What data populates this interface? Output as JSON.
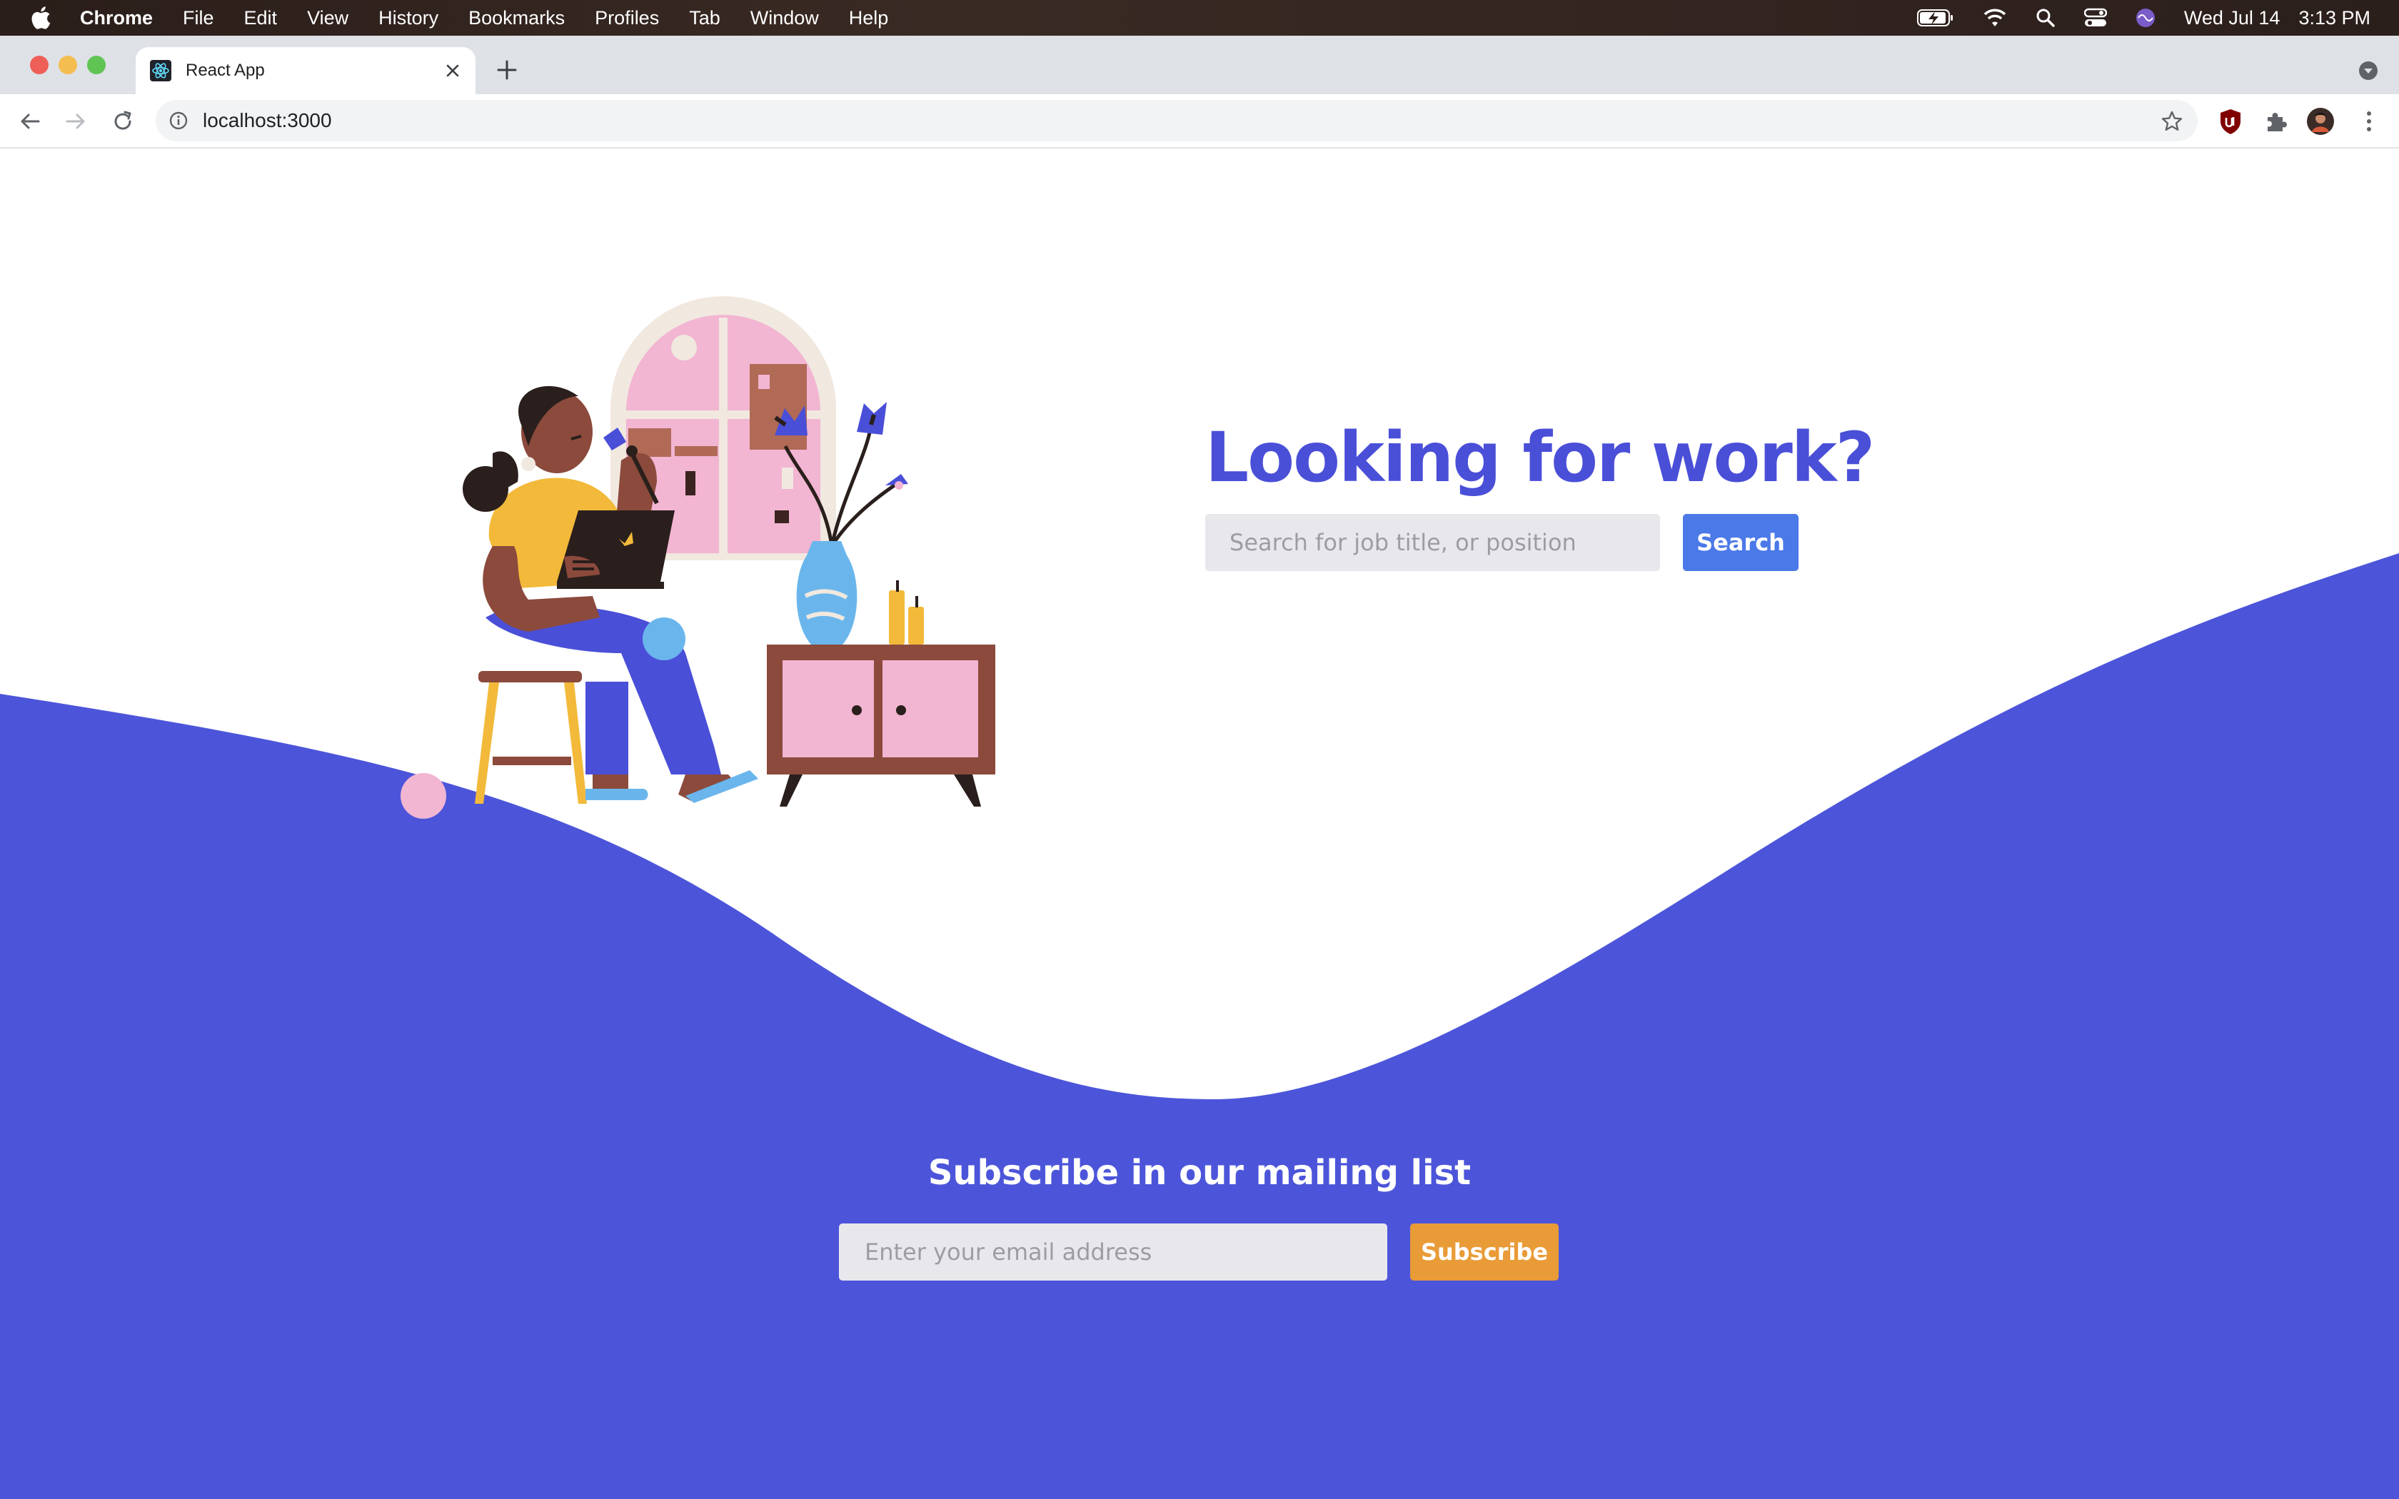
{
  "menubar": {
    "app_name": "Chrome",
    "items": [
      "File",
      "Edit",
      "View",
      "History",
      "Bookmarks",
      "Profiles",
      "Tab",
      "Window",
      "Help"
    ],
    "date": "Wed Jul 14",
    "time": "3:13 PM"
  },
  "browser": {
    "tab_title": "React App",
    "url": "localhost:3000"
  },
  "hero": {
    "title": "Looking for work?",
    "search_placeholder": "Search for job title, or position",
    "search_label": "Search"
  },
  "subscribe": {
    "title": "Subscribe in our mailing list",
    "email_placeholder": "Enter your email address",
    "button_label": "Subscribe"
  },
  "colors": {
    "brand_blue": "#4a4fd8",
    "wave_blue": "#4c55d9",
    "search_button": "#4b79e8",
    "subscribe_button": "#e99b37"
  }
}
